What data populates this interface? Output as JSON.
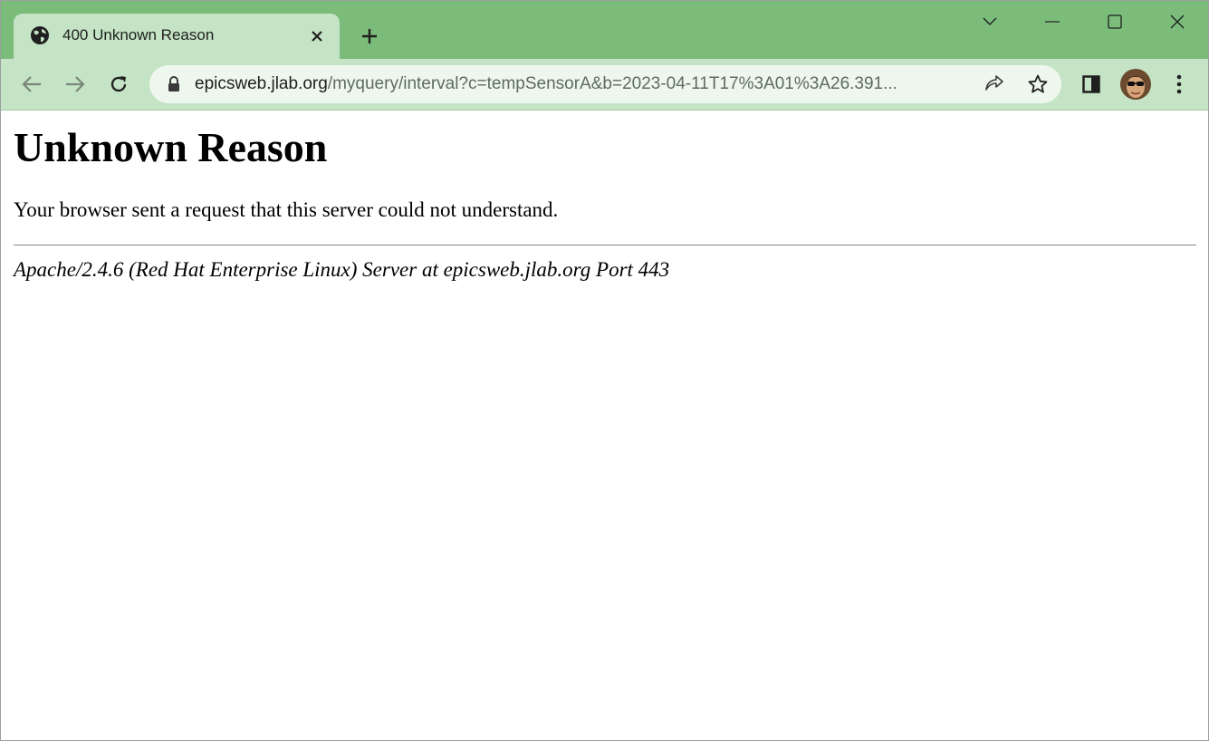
{
  "tab": {
    "title": "400 Unknown Reason"
  },
  "omnibox": {
    "host": "epicsweb.jlab.org",
    "path": "/myquery/interval?c=tempSensorA&b=2023-04-11T17%3A01%3A26.391..."
  },
  "page": {
    "heading": "Unknown Reason",
    "message": "Your browser sent a request that this server could not understand.",
    "footer": "Apache/2.4.6 (Red Hat Enterprise Linux) Server at epicsweb.jlab.org Port 443"
  },
  "colors": {
    "tabstrip": "#7bbc7b",
    "toolbar": "#c5e3c5",
    "omnibox": "#eef7ee"
  },
  "icons": [
    "globe-icon",
    "close-icon",
    "plus-icon",
    "chevron-down-icon",
    "minimize-icon",
    "maximize-icon",
    "window-close-icon",
    "back-icon",
    "forward-icon",
    "reload-icon",
    "lock-icon",
    "share-icon",
    "star-icon",
    "side-panel-icon",
    "avatar",
    "kebab-menu-icon"
  ]
}
